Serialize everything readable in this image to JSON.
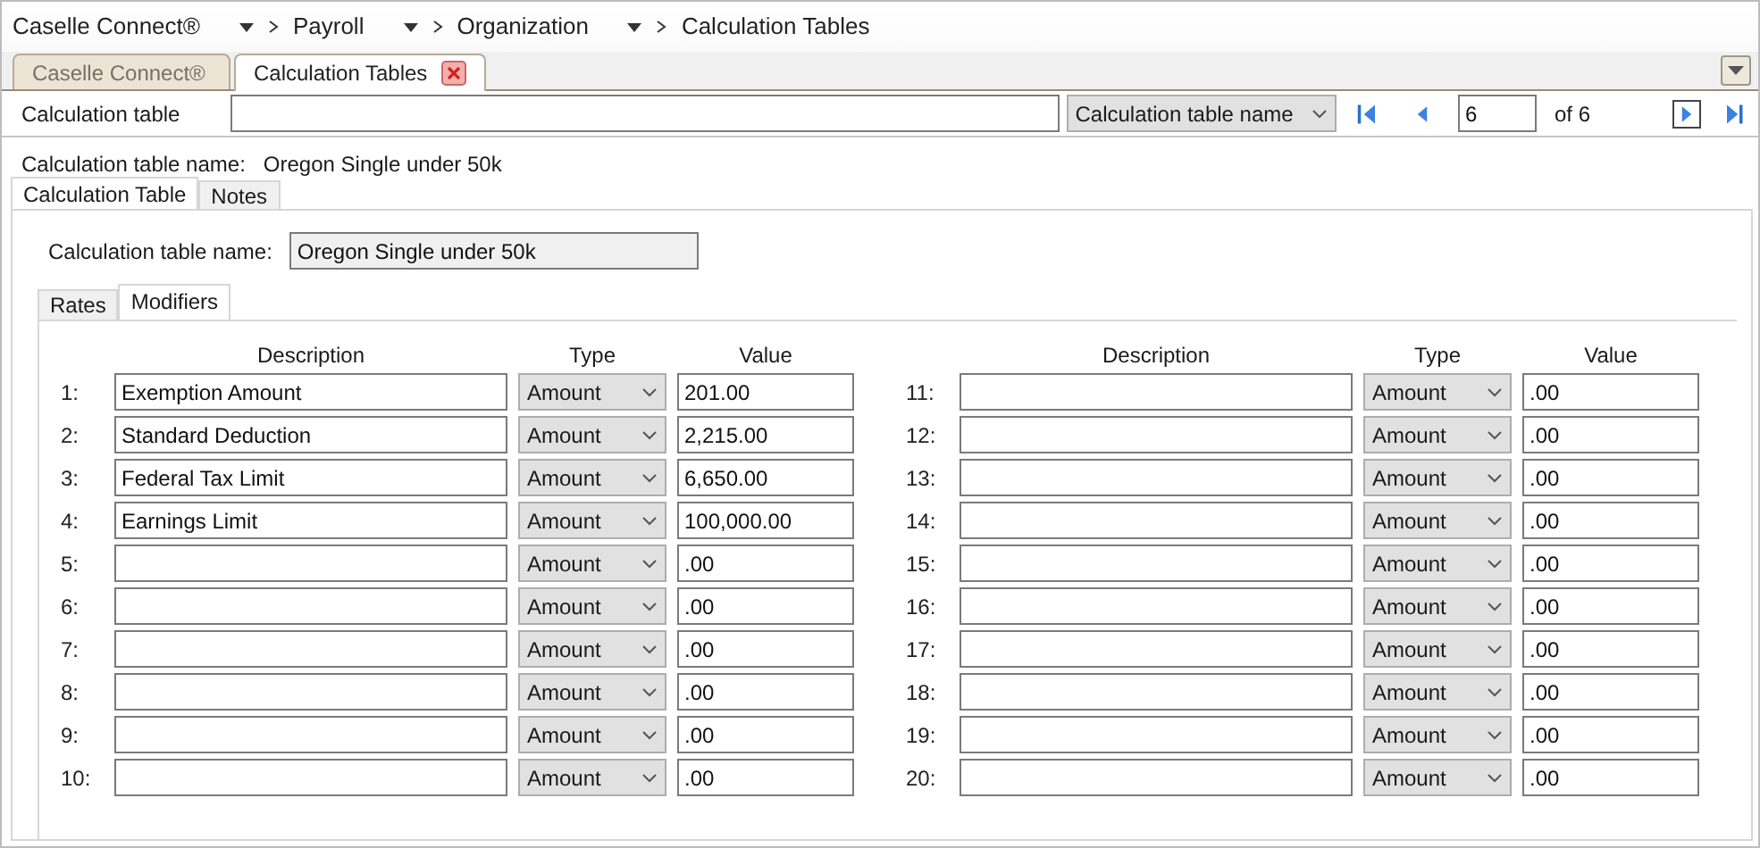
{
  "breadcrumb": [
    {
      "label": "Caselle Connect®",
      "dropdown": true
    },
    {
      "label": "Payroll",
      "dropdown": true
    },
    {
      "label": "Organization",
      "dropdown": true
    },
    {
      "label": "Calculation Tables",
      "dropdown": false
    }
  ],
  "document_tabs": [
    {
      "label": "Caselle Connect®",
      "selected": false,
      "closable": false
    },
    {
      "label": "Calculation Tables",
      "selected": true,
      "closable": true
    }
  ],
  "toolbar": {
    "label": "Calculation table",
    "search_by": "Calculation table name",
    "navigation": [
      {
        "kind": "first",
        "focused": false
      },
      {
        "kind": "previous",
        "focused": false
      },
      {
        "kind": "page",
        "value": "6"
      },
      {
        "kind": "count",
        "text": "of 6"
      },
      {
        "kind": "next",
        "focused": true
      },
      {
        "kind": "last",
        "focused": false
      }
    ]
  },
  "record": {
    "label": "Calculation table name:",
    "value": "Oregon Single under 50k"
  },
  "main_tabs": [
    {
      "label": "Calculation Table",
      "selected": true
    },
    {
      "label": "Notes",
      "selected": false
    }
  ],
  "name_field": {
    "label": "Calculation table name:",
    "value": "Oregon Single under 50k"
  },
  "sub_tabs": [
    {
      "label": "Rates",
      "selected": false
    },
    {
      "label": "Modifiers",
      "selected": true
    }
  ],
  "modifiers": [
    {
      "headers": [
        "Description",
        "Type",
        "Value"
      ],
      "rows": [
        {
          "number": "1:",
          "description": "Exemption Amount",
          "type": "Amount",
          "value": "201.00"
        },
        {
          "number": "2:",
          "description": "Standard Deduction",
          "type": "Amount",
          "value": "2,215.00"
        },
        {
          "number": "3:",
          "description": "Federal Tax Limit",
          "type": "Amount",
          "value": "6,650.00"
        },
        {
          "number": "4:",
          "description": "Earnings Limit",
          "type": "Amount",
          "value": "100,000.00"
        },
        {
          "number": "5:",
          "description": "",
          "type": "Amount",
          "value": ".00"
        },
        {
          "number": "6:",
          "description": "",
          "type": "Amount",
          "value": ".00"
        },
        {
          "number": "7:",
          "description": "",
          "type": "Amount",
          "value": ".00"
        },
        {
          "number": "8:",
          "description": "",
          "type": "Amount",
          "value": ".00"
        },
        {
          "number": "9:",
          "description": "",
          "type": "Amount",
          "value": ".00"
        },
        {
          "number": "10:",
          "description": "",
          "type": "Amount",
          "value": ".00"
        }
      ]
    },
    {
      "headers": [
        "Description",
        "Type",
        "Value"
      ],
      "rows": [
        {
          "number": "11:",
          "description": "",
          "type": "Amount",
          "value": ".00"
        },
        {
          "number": "12:",
          "description": "",
          "type": "Amount",
          "value": ".00"
        },
        {
          "number": "13:",
          "description": "",
          "type": "Amount",
          "value": ".00"
        },
        {
          "number": "14:",
          "description": "",
          "type": "Amount",
          "value": ".00"
        },
        {
          "number": "15:",
          "description": "",
          "type": "Amount",
          "value": ".00"
        },
        {
          "number": "16:",
          "description": "",
          "type": "Amount",
          "value": ".00"
        },
        {
          "number": "17:",
          "description": "",
          "type": "Amount",
          "value": ".00"
        },
        {
          "number": "18:",
          "description": "",
          "type": "Amount",
          "value": ".00"
        },
        {
          "number": "19:",
          "description": "",
          "type": "Amount",
          "value": ".00"
        },
        {
          "number": "20:",
          "description": "",
          "type": "Amount",
          "value": ".00"
        }
      ]
    }
  ]
}
